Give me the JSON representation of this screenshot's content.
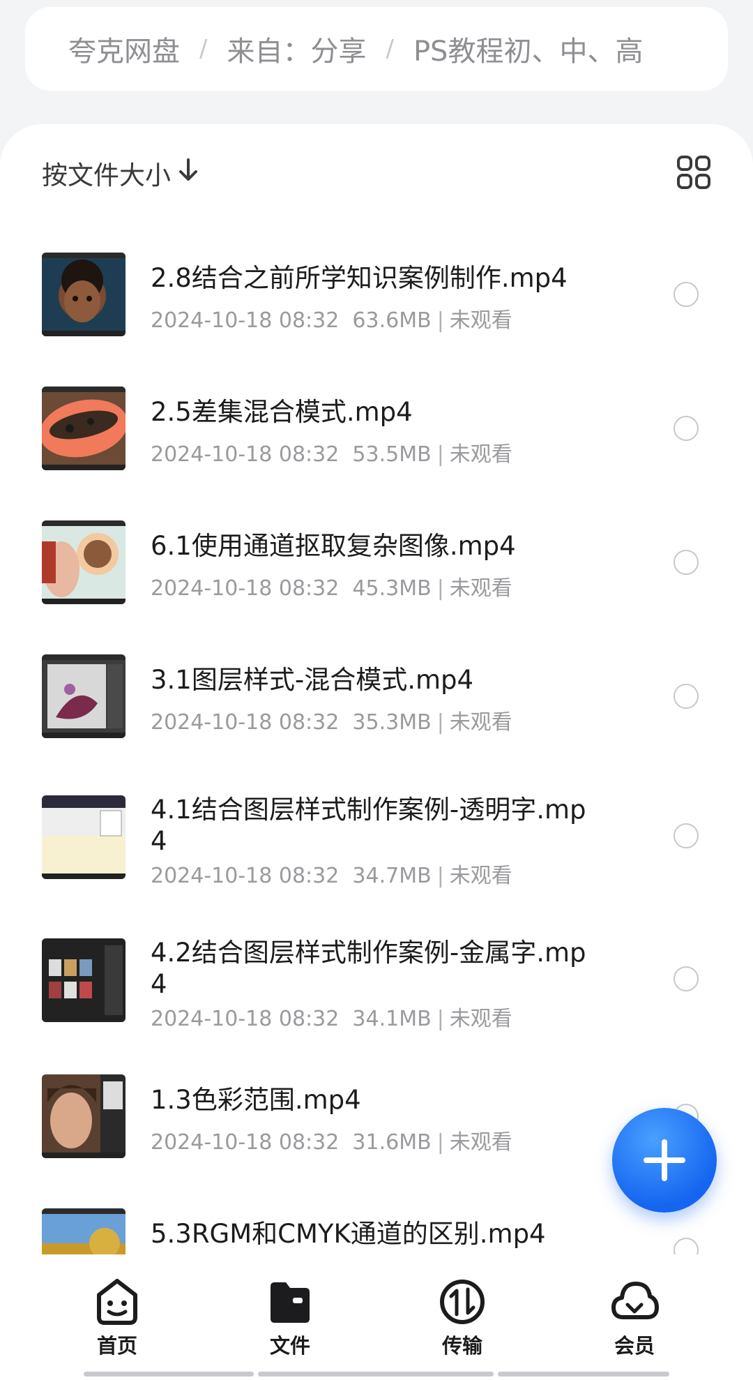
{
  "breadcrumb": {
    "items": [
      "夸克网盘",
      "来自：分享",
      "PS教程初、中、高"
    ],
    "separator": "/"
  },
  "toolbar": {
    "sort_label": "按文件大小",
    "sort_arrow": "↓",
    "grid_icon": "grid-view-icon"
  },
  "files": [
    {
      "name": "2.8结合之前所学知识案例制作.mp4",
      "date": "2024-10-18 08:32",
      "size": "63.6MB",
      "status": "未观看"
    },
    {
      "name": "2.5差集混合模式.mp4",
      "date": "2024-10-18 08:32",
      "size": "53.5MB",
      "status": "未观看"
    },
    {
      "name": "6.1使用通道抠取复杂图像.mp4",
      "date": "2024-10-18 08:32",
      "size": "45.3MB",
      "status": "未观看"
    },
    {
      "name": "3.1图层样式-混合模式.mp4",
      "date": "2024-10-18 08:32",
      "size": "35.3MB",
      "status": "未观看"
    },
    {
      "name": "4.1结合图层样式制作案例-透明字.mp4",
      "date": "2024-10-18 08:32",
      "size": "34.7MB",
      "status": "未观看"
    },
    {
      "name": "4.2结合图层样式制作案例-金属字.mp4",
      "date": "2024-10-18 08:32",
      "size": "34.1MB",
      "status": "未观看"
    },
    {
      "name": "1.3色彩范围.mp4",
      "date": "2024-10-18 08:32",
      "size": "31.6MB",
      "status": "未观看"
    },
    {
      "name": "5.3RGM和CMYK通道的区别.mp4",
      "date": "",
      "size": "",
      "status": ""
    }
  ],
  "fab": {
    "icon": "plus-icon"
  },
  "nav": {
    "items": [
      {
        "label": "首页",
        "icon": "smiley-home-icon"
      },
      {
        "label": "文件",
        "icon": "folder-file-icon"
      },
      {
        "label": "传输",
        "icon": "transfer-icon"
      },
      {
        "label": "会员",
        "icon": "cloud-member-icon"
      }
    ],
    "active": 1
  },
  "colors": {
    "accent": "#1565f0",
    "text": "#1c1c1e",
    "muted": "#9a9a9e"
  }
}
